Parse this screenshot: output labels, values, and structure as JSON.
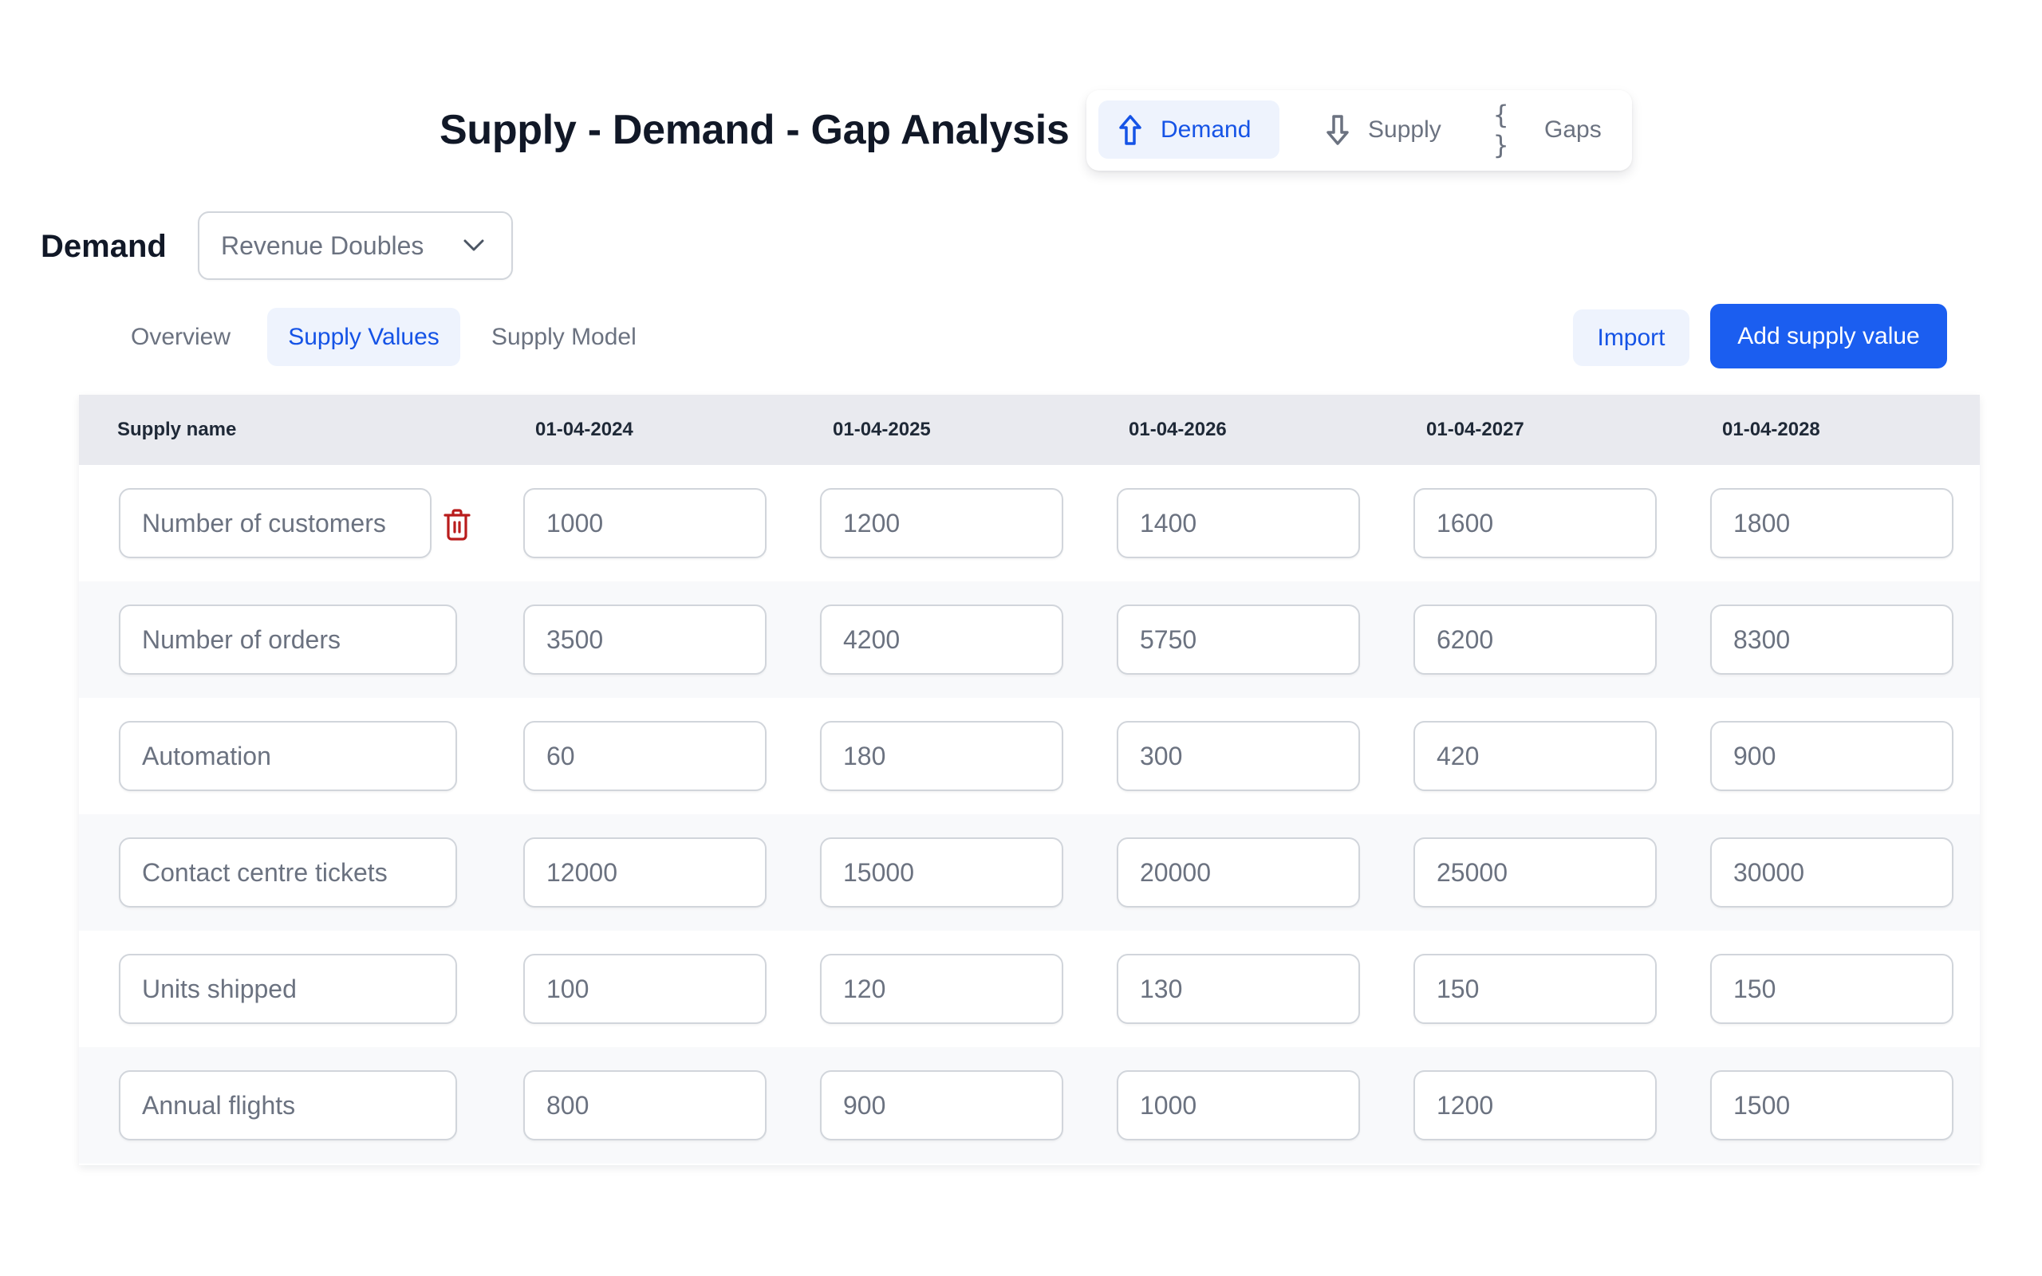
{
  "header": {
    "title": "Supply - Demand - Gap Analysis"
  },
  "mode_switch": {
    "items": [
      {
        "label": "Demand",
        "icon": "arrow-up-outline-icon",
        "active": true
      },
      {
        "label": "Supply",
        "icon": "arrow-down-outline-icon",
        "active": false
      },
      {
        "label": "Gaps",
        "icon": "braces-icon",
        "icon_glyph": "{ }",
        "active": false
      }
    ]
  },
  "demand_selector": {
    "label": "Demand",
    "selected": "Revenue Doubles",
    "icon": "chevron-down-icon"
  },
  "tabs": [
    {
      "label": "Overview",
      "active": false
    },
    {
      "label": "Supply Values",
      "active": true
    },
    {
      "label": "Supply Model",
      "active": false
    }
  ],
  "actions": {
    "import_label": "Import",
    "add_label": "Add supply value"
  },
  "colors": {
    "primary": "#1b5ef0",
    "active_text": "#1553e6",
    "active_bg": "#eef3fd",
    "danger": "#b91c1c",
    "header_bg": "#e9eaef",
    "alt_row_bg": "#f8f9fb"
  },
  "table": {
    "columns": [
      "Supply name",
      "01-04-2024",
      "01-04-2025",
      "01-04-2026",
      "01-04-2027",
      "01-04-2028"
    ],
    "rows": [
      {
        "name": "Number of customers",
        "values": [
          "1000",
          "1200",
          "1400",
          "1600",
          "1800"
        ],
        "show_delete": true
      },
      {
        "name": "Number of orders",
        "values": [
          "3500",
          "4200",
          "5750",
          "6200",
          "8300"
        ],
        "show_delete": false
      },
      {
        "name": "Automation",
        "values": [
          "60",
          "180",
          "300",
          "420",
          "900"
        ],
        "show_delete": false
      },
      {
        "name": "Contact centre tickets",
        "values": [
          "12000",
          "15000",
          "20000",
          "25000",
          "30000"
        ],
        "show_delete": false
      },
      {
        "name": "Units shipped",
        "values": [
          "100",
          "120",
          "130",
          "150",
          "150"
        ],
        "show_delete": false
      },
      {
        "name": "Annual flights",
        "values": [
          "800",
          "900",
          "1000",
          "1200",
          "1500"
        ],
        "show_delete": false
      }
    ]
  }
}
